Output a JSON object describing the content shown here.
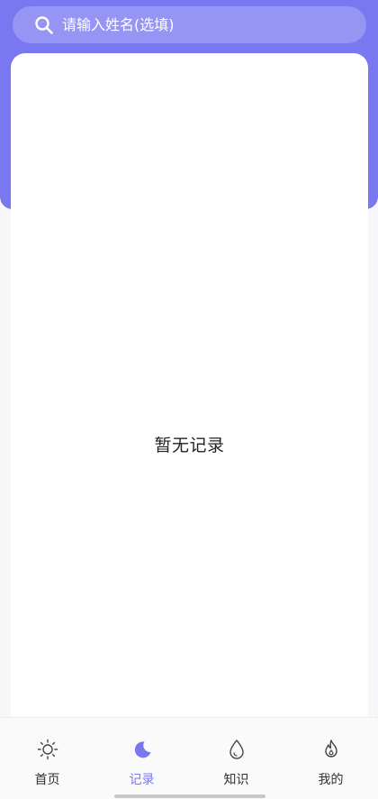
{
  "search": {
    "placeholder": "请输入姓名(选填)"
  },
  "records": {
    "empty_text": "暂无记录"
  },
  "tabs": [
    {
      "label": "首页",
      "icon": "sun-icon",
      "active": false
    },
    {
      "label": "记录",
      "icon": "moon-icon",
      "active": true
    },
    {
      "label": "知识",
      "icon": "drop-icon",
      "active": false
    },
    {
      "label": "我的",
      "icon": "flame-icon",
      "active": false
    }
  ],
  "colors": {
    "accent": "#7a78f0",
    "tab_text": "#333333",
    "background": "#f7f7f9"
  }
}
